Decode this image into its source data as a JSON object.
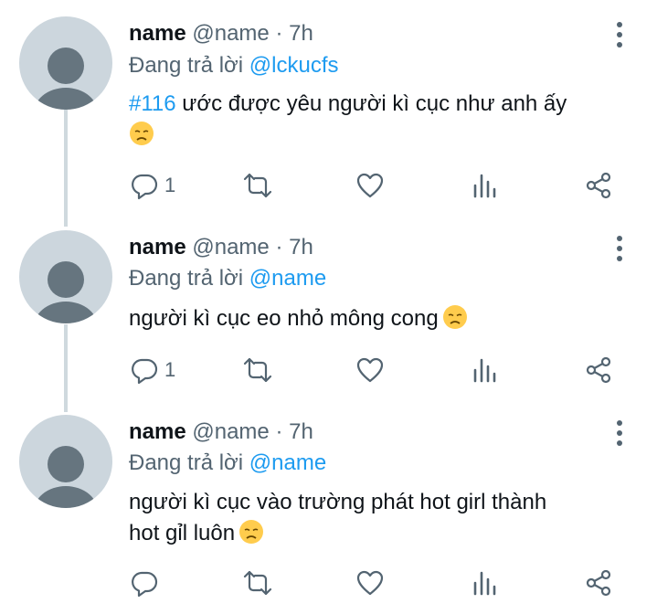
{
  "tweets": [
    {
      "name": "name",
      "handle": "@name",
      "dot": "·",
      "time": "7h",
      "replying_prefix": "Đang trả lời",
      "replying_to": "@lckucfs",
      "hashtag": "#116",
      "text": " ước được yêu người kì cục như anh ấy",
      "text_line2": "",
      "emoji": "disappointed-face",
      "reply_count": "1"
    },
    {
      "name": "name",
      "handle": "@name",
      "dot": "·",
      "time": "7h",
      "replying_prefix": "Đang trả lời",
      "replying_to": "@name",
      "text": "người kì cục eo nhỏ mông cong",
      "emoji": "disappointed-face",
      "reply_count": "1"
    },
    {
      "name": "name",
      "handle": "@name",
      "dot": "·",
      "time": "7h",
      "replying_prefix": "Đang trả lời",
      "replying_to": "@name",
      "text": "người kì cục vào trường phát hot girl thành",
      "text_line2": "hot gỉl luôn",
      "emoji": "disappointed-face",
      "reply_count": ""
    }
  ],
  "icons": {
    "reply": "reply-icon",
    "retweet": "retweet-icon",
    "like": "like-icon",
    "views": "views-icon",
    "share": "share-icon",
    "more": "more-icon"
  },
  "colors": {
    "accent": "#1d9bf0",
    "secondary_text": "#536471",
    "avatar_bg": "#ccd6dd",
    "avatar_fg": "#66757f",
    "thread_line": "#cfd9de",
    "emoji": "#ffcc4d"
  }
}
